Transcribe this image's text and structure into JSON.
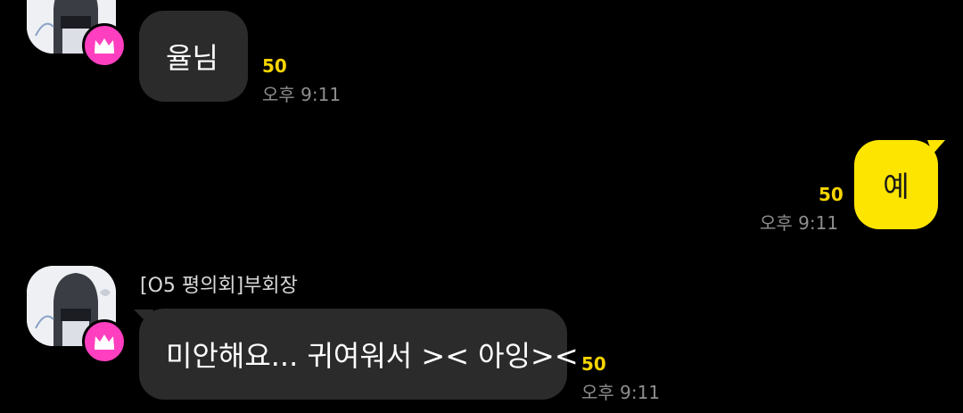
{
  "colors": {
    "background": "#000000",
    "incoming_bubble": "#2b2b2b",
    "outgoing_bubble": "#fee500",
    "unread_count": "#f5d400",
    "timestamp": "#8e8e8e",
    "crown_badge": "#ff3fbf"
  },
  "messages": [
    {
      "direction": "incoming",
      "text": "율님",
      "unread": "50",
      "time": "오후 9:11",
      "avatar_icon": "profile-avatar-icon",
      "badge_icon": "crown-icon"
    },
    {
      "direction": "outgoing",
      "text": "예",
      "unread": "50",
      "time": "오후 9:11"
    },
    {
      "direction": "incoming",
      "sender": "[O5 평의회]부회장",
      "text": "미안해요... 귀여워서 >< 아잉><",
      "unread": "50",
      "time": "오후 9:11",
      "avatar_icon": "profile-avatar-icon",
      "badge_icon": "crown-icon"
    }
  ]
}
